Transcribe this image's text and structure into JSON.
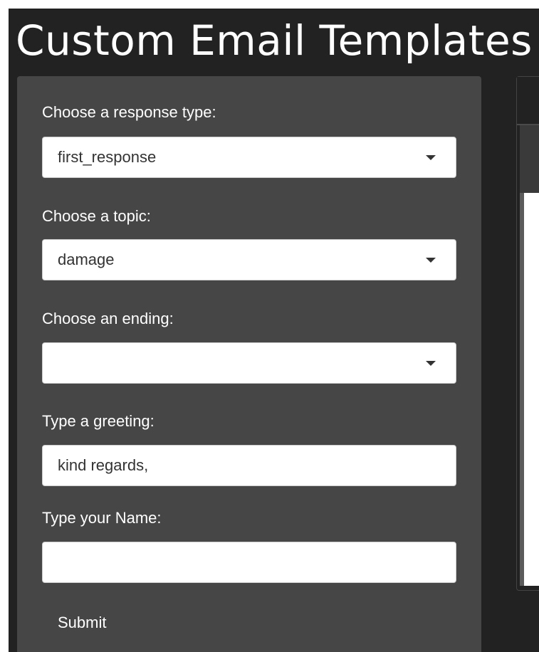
{
  "app": {
    "title": "Custom Email Templates"
  },
  "form": {
    "response_type": {
      "label": "Choose a response type:",
      "value": "first_response"
    },
    "topic": {
      "label": "Choose a topic:",
      "value": "damage"
    },
    "ending": {
      "label": "Choose an ending:",
      "value": ""
    },
    "greeting": {
      "label": "Type a greeting:",
      "value": "kind regards,"
    },
    "name": {
      "label": "Type your Name:",
      "value": ""
    },
    "submit_label": "Submit"
  },
  "theme": {
    "background": "#222222",
    "sidebar": "#464646",
    "text": "#ffffff"
  },
  "icons": {
    "dropdown": "caret-down-icon"
  }
}
